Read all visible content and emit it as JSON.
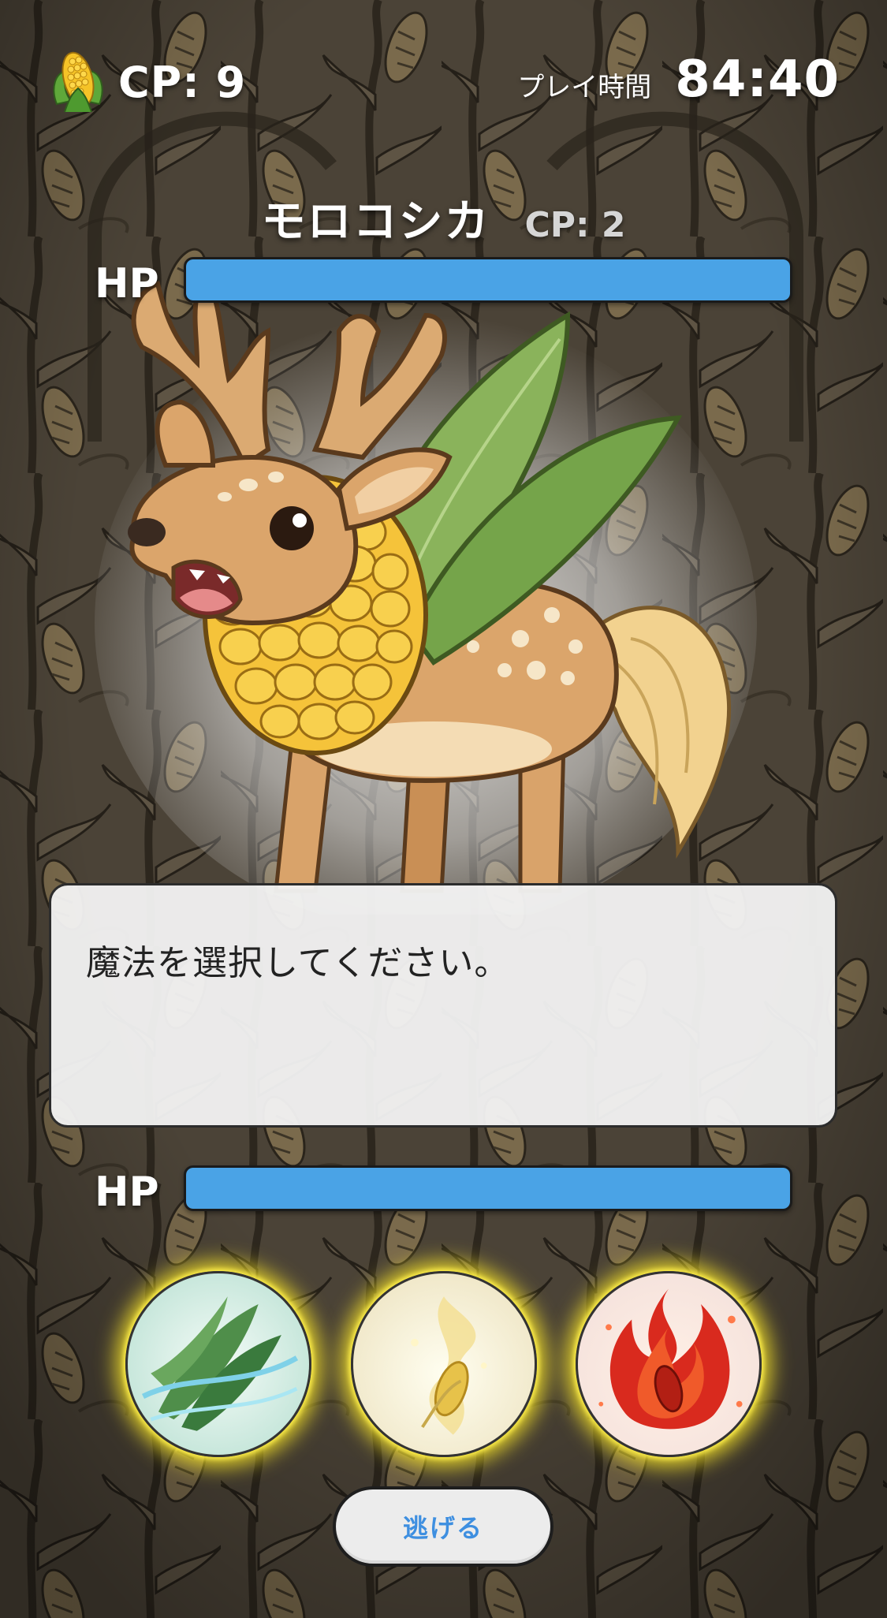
{
  "hud": {
    "cp_icon": "corn-icon",
    "cp_label": "CP: 9",
    "time_label": "プレイ時間",
    "time_value": "84:40"
  },
  "enemy": {
    "name": "モロコシカ",
    "cp_label": "CP: 2",
    "hp_label": "HP",
    "hp_fraction": 1.0,
    "image": "corn-deer-monster"
  },
  "message": {
    "text": "魔法を選択してください。"
  },
  "player": {
    "hp_label": "HP",
    "hp_fraction": 1.0
  },
  "magic": [
    {
      "icon": "wind-leaf-magic-icon"
    },
    {
      "icon": "light-corn-magic-icon"
    },
    {
      "icon": "fire-corn-magic-icon"
    }
  ],
  "actions": {
    "escape_label": "逃げる"
  },
  "colors": {
    "hp_bar": "#4aa3e6",
    "escape_text": "#3e8fe0",
    "magic_glow": "#ffe928",
    "background": "#4a4236"
  }
}
